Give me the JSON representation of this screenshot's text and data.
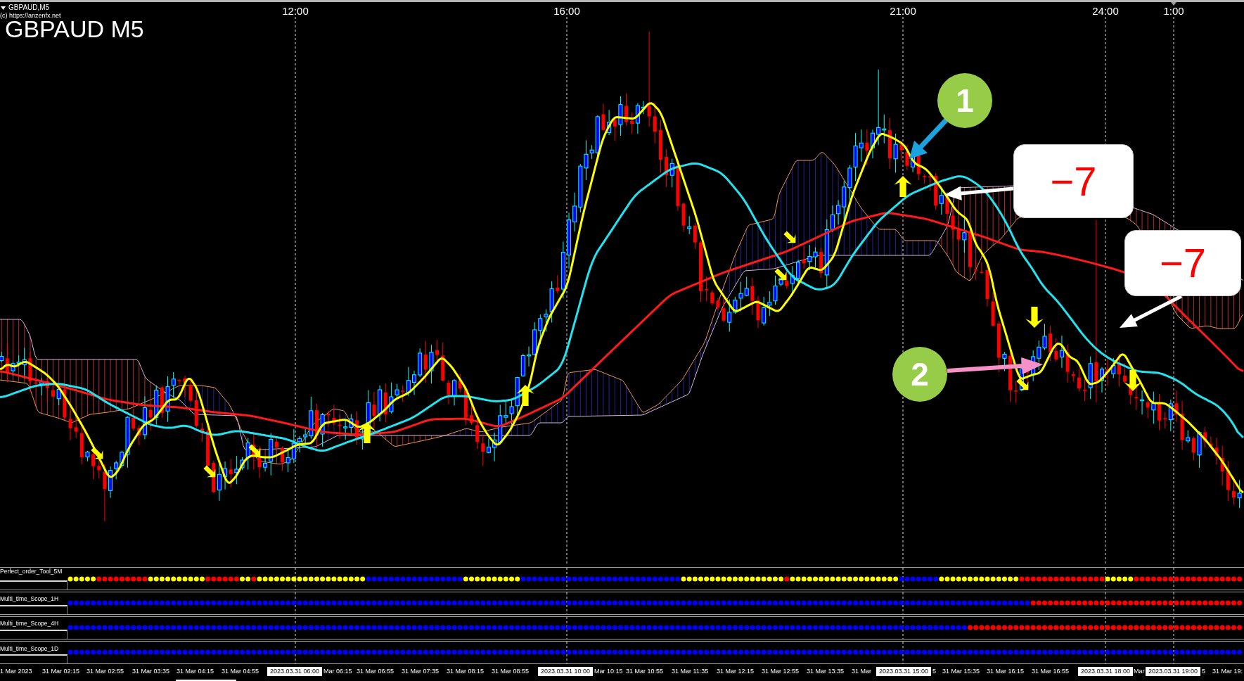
{
  "chart": {
    "symbol_label": "GBPAUD,M5",
    "copyright": "(c) https://anzenfx.net",
    "title": "GBPAUD M5",
    "time_labels": [
      "12:00",
      "16:00",
      "21:00",
      "24:00",
      "1:00"
    ]
  },
  "annotations": [
    {
      "kind": "number",
      "text": "1"
    },
    {
      "kind": "value",
      "text": "−7"
    },
    {
      "kind": "value",
      "text": "−7"
    },
    {
      "kind": "number",
      "text": "2"
    }
  ],
  "indicator_panes": [
    {
      "label": "Perfect_order_Tool_5M"
    },
    {
      "label": "Multi_time_Scope_1H"
    },
    {
      "label": "Multi_time_Scope_4H"
    },
    {
      "label": "Multi_time_Scope_1D"
    }
  ],
  "time_axis": [
    {
      "text": "1 Mar 2023",
      "kind": "plain"
    },
    {
      "text": "31 Mar 02:15",
      "kind": "plain"
    },
    {
      "text": "31 Mar 02:55",
      "kind": "plain"
    },
    {
      "text": "31 Mar 03:35",
      "kind": "plain"
    },
    {
      "text": "31 Mar 04:15",
      "kind": "plain"
    },
    {
      "text": "31 Mar 04:55",
      "kind": "plain"
    },
    {
      "text": "2023.03.31 06:00",
      "kind": "boxed"
    },
    {
      "text": "Mar 06:15",
      "kind": "plain"
    },
    {
      "text": "31 Mar 06:55",
      "kind": "plain"
    },
    {
      "text": "31 Mar 07:35",
      "kind": "plain"
    },
    {
      "text": "31 Mar 08:15",
      "kind": "plain"
    },
    {
      "text": "31 Mar 08:55",
      "kind": "plain"
    },
    {
      "text": "2023.03.31 10:00",
      "kind": "boxed"
    },
    {
      "text": "Mar 10:15",
      "kind": "plain"
    },
    {
      "text": "31 Mar 10:55",
      "kind": "plain"
    },
    {
      "text": "31 Mar 11:35",
      "kind": "plain"
    },
    {
      "text": "31 Mar 12:15",
      "kind": "plain"
    },
    {
      "text": "31 Mar 12:55",
      "kind": "plain"
    },
    {
      "text": "31 Mar 13:35",
      "kind": "plain"
    },
    {
      "text": "31 Mar",
      "kind": "plain"
    },
    {
      "text": "2023.03.31 15:00",
      "kind": "boxed"
    },
    {
      "text": "5",
      "kind": "plain"
    },
    {
      "text": "31 Mar 15:35",
      "kind": "plain"
    },
    {
      "text": "31 Mar 16:15",
      "kind": "plain"
    },
    {
      "text": "31 Mar 16:55",
      "kind": "plain"
    },
    {
      "text": "2023.03.31 18:00",
      "kind": "boxed"
    },
    {
      "text": "Mar",
      "kind": "plain"
    },
    {
      "text": "2023.03.31 19:00",
      "kind": "boxed"
    },
    {
      "text": "5",
      "kind": "plain"
    },
    {
      "text": "31 Mar 19:",
      "kind": "plain"
    }
  ]
}
